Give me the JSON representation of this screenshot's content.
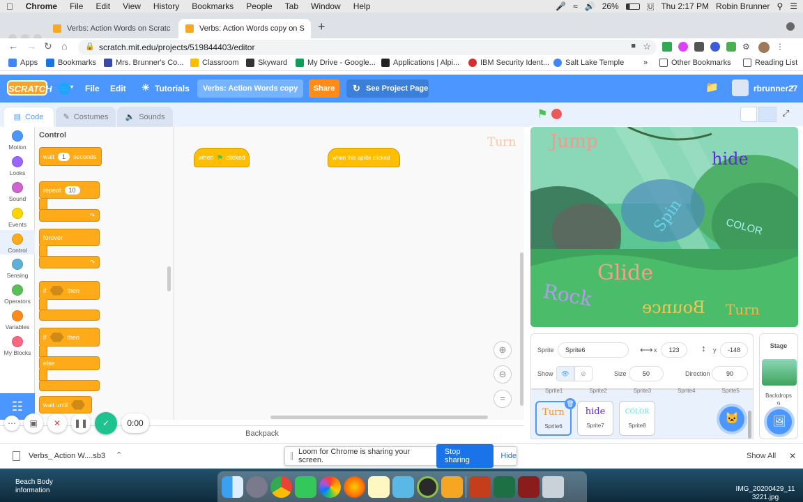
{
  "menubar": {
    "apple": "",
    "app": "Chrome",
    "items": [
      "File",
      "Edit",
      "View",
      "History",
      "Bookmarks",
      "People",
      "Tab",
      "Window",
      "Help"
    ],
    "battery": "26%",
    "clock": "Thu 2:17 PM",
    "user": "Robin Brunner"
  },
  "browser": {
    "tabs": [
      {
        "title": "Verbs: Action Words on Scratc",
        "active": false
      },
      {
        "title": "Verbs: Action Words copy on S",
        "active": true
      }
    ],
    "new_tab": "+",
    "url": "scratch.mit.edu/projects/519844403/editor",
    "bookmarks": [
      "Apps",
      "Bookmarks",
      "Mrs. Brunner's Co...",
      "Classroom",
      "Skyward",
      "My Drive - Google...",
      "Applications | Alpi...",
      "IBM Security Ident...",
      "Salt Lake Temple"
    ],
    "bookmarks_more": "»",
    "other_bookmarks": "Other Bookmarks",
    "reading_list": "Reading List"
  },
  "scratch": {
    "logo": "SCRATCH",
    "menu": {
      "file": "File",
      "edit": "Edit",
      "tutorials": "Tutorials"
    },
    "project_title": "Verbs: Action Words copy",
    "share": "Share",
    "see_project": "See Project Page",
    "username": "rbrunner27",
    "editor_tabs": [
      "Code",
      "Costumes",
      "Sounds"
    ],
    "categories": [
      {
        "label": "Motion",
        "color": "#4c97ff"
      },
      {
        "label": "Looks",
        "color": "#9966ff"
      },
      {
        "label": "Sound",
        "color": "#cf63cf"
      },
      {
        "label": "Events",
        "color": "#ffd500"
      },
      {
        "label": "Control",
        "color": "#ffab19"
      },
      {
        "label": "Sensing",
        "color": "#5cb1d6"
      },
      {
        "label": "Operators",
        "color": "#59c059"
      },
      {
        "label": "Variables",
        "color": "#ff8c1a"
      },
      {
        "label": "My Blocks",
        "color": "#ff6680"
      }
    ],
    "palette": {
      "heading": "Control",
      "wait": {
        "label": "wait",
        "value": "1",
        "suffix": "seconds"
      },
      "repeat": {
        "label": "repeat",
        "value": "10"
      },
      "forever": "forever",
      "if_then": {
        "if": "if",
        "then": "then"
      },
      "if_else": {
        "if": "if",
        "then": "then",
        "else": "else"
      },
      "wait_until": "wait until"
    },
    "script": {
      "when_flag": {
        "pre": "when",
        "post": "clicked"
      },
      "when_sprite": "when this sprite clicked",
      "ghost_costume": "Turn"
    },
    "backpack": "Backpack",
    "loom_timer": "0:00",
    "stage_words": {
      "jump": "Jump",
      "hide": "hide",
      "spin": "Spin",
      "color": "COLOR",
      "glide": "Glide",
      "rock": "Rock",
      "bounce": "Bounce",
      "turn": "Turn"
    },
    "sprite_info": {
      "sprite_label": "Sprite",
      "sprite_name": "Sprite6",
      "x_label": "x",
      "x": "123",
      "y_label": "y",
      "y": "-148",
      "show_label": "Show",
      "size_label": "Size",
      "size": "50",
      "direction_label": "Direction",
      "direction": "90"
    },
    "sprite_strip": [
      "Sprite1",
      "Sprite2",
      "Sprite3",
      "Sprite4",
      "Sprite5"
    ],
    "sprites": [
      {
        "name": "Sprite6",
        "costume": "Turn",
        "color": "#ff8c1a",
        "selected": true
      },
      {
        "name": "Sprite7",
        "costume": "hide",
        "color": "#5a2bd6",
        "selected": false
      },
      {
        "name": "Sprite8",
        "costume": "COLOR",
        "color": "#5fe0d8",
        "selected": false
      }
    ],
    "stage_panel": {
      "label": "Stage",
      "backdrops": "Backdrops",
      "count": "9"
    }
  },
  "download": {
    "file": "Verbs_ Action W....sb3",
    "show_all": "Show All",
    "close": "✕"
  },
  "loom": {
    "message": "Loom for Chrome is sharing your screen.",
    "stop": "Stop sharing",
    "hide": "Hide"
  },
  "desktop": {
    "left_file": "Beach Body\ninformation",
    "right_file": "IMG_20200429_11\n3221.jpg"
  }
}
